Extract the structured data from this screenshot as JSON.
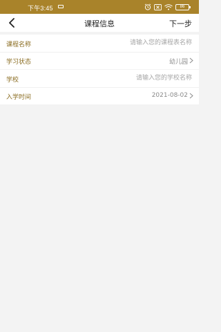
{
  "status_bar": {
    "time": "下午3:45",
    "battery": "86",
    "icons": [
      "message-icon",
      "alarm-icon",
      "sim-x-icon",
      "wifi-icon",
      "battery-icon"
    ],
    "color": "#a9832a"
  },
  "nav": {
    "back_icon": "chevron-left-icon",
    "title": "课程信息",
    "next_label": "下一步"
  },
  "form": {
    "group1": {
      "course_name": {
        "label": "课程名称",
        "placeholder": "请输入您的课程表名称"
      },
      "study_status": {
        "label": "学习状态",
        "value": "幼儿园"
      }
    },
    "group2": {
      "school": {
        "label": "学校",
        "placeholder": "请输入您的学校名称"
      },
      "enroll_time": {
        "label": "入学时间",
        "value": "2021-08-02"
      }
    }
  },
  "colors": {
    "label": "#8b6d22",
    "background": "#f3f3f3"
  }
}
